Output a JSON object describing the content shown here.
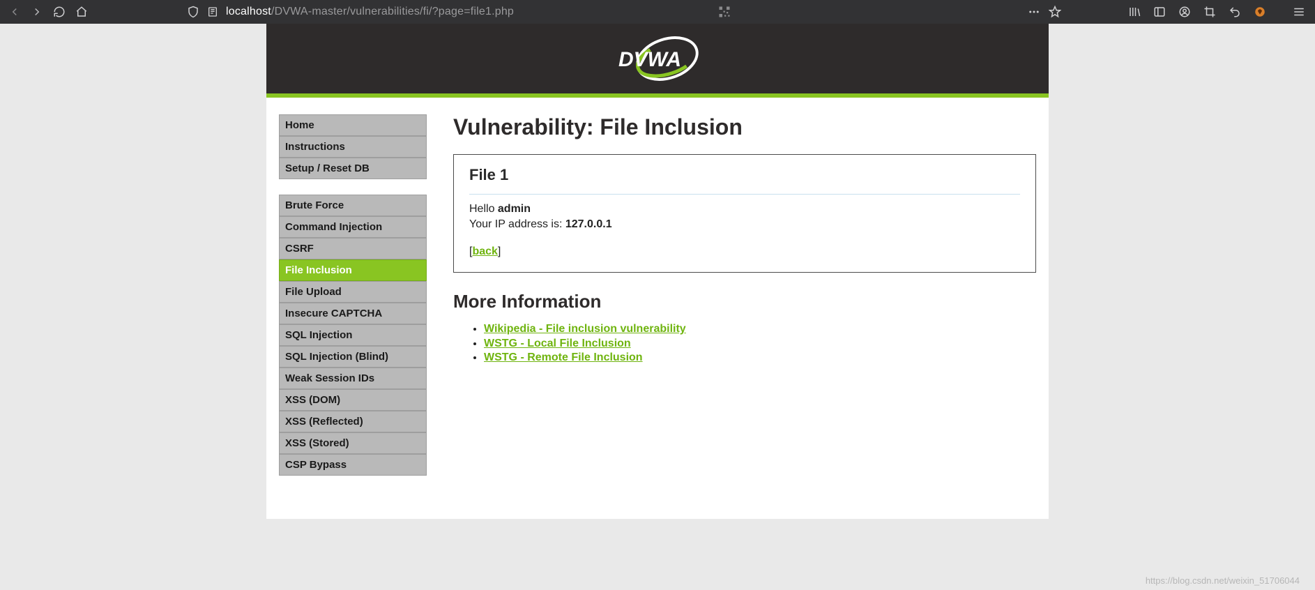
{
  "browser": {
    "url_host": "localhost",
    "url_path": "/DVWA-master/vulnerabilities/fi/?page=file1.php"
  },
  "logo_text": "DVWA",
  "sidebar": {
    "group1": [
      {
        "label": "Home"
      },
      {
        "label": "Instructions"
      },
      {
        "label": "Setup / Reset DB"
      }
    ],
    "group2": [
      {
        "label": "Brute Force"
      },
      {
        "label": "Command Injection"
      },
      {
        "label": "CSRF"
      },
      {
        "label": "File Inclusion",
        "active": true
      },
      {
        "label": "File Upload"
      },
      {
        "label": "Insecure CAPTCHA"
      },
      {
        "label": "SQL Injection"
      },
      {
        "label": "SQL Injection (Blind)"
      },
      {
        "label": "Weak Session IDs"
      },
      {
        "label": "XSS (DOM)"
      },
      {
        "label": "XSS (Reflected)"
      },
      {
        "label": "XSS (Stored)"
      },
      {
        "label": "CSP Bypass"
      }
    ]
  },
  "content": {
    "title": "Vulnerability: File Inclusion",
    "file_heading": "File 1",
    "hello_prefix": "Hello ",
    "hello_user": "admin",
    "ip_prefix": "Your IP address is: ",
    "ip_value": "127.0.0.1",
    "back_open": "[",
    "back_label": "back",
    "back_close": "]",
    "more_info_heading": "More Information",
    "links": [
      {
        "label": "Wikipedia - File inclusion vulnerability"
      },
      {
        "label": "WSTG - Local File Inclusion"
      },
      {
        "label": "WSTG - Remote File Inclusion"
      }
    ]
  },
  "watermark": "https://blog.csdn.net/weixin_51706044"
}
